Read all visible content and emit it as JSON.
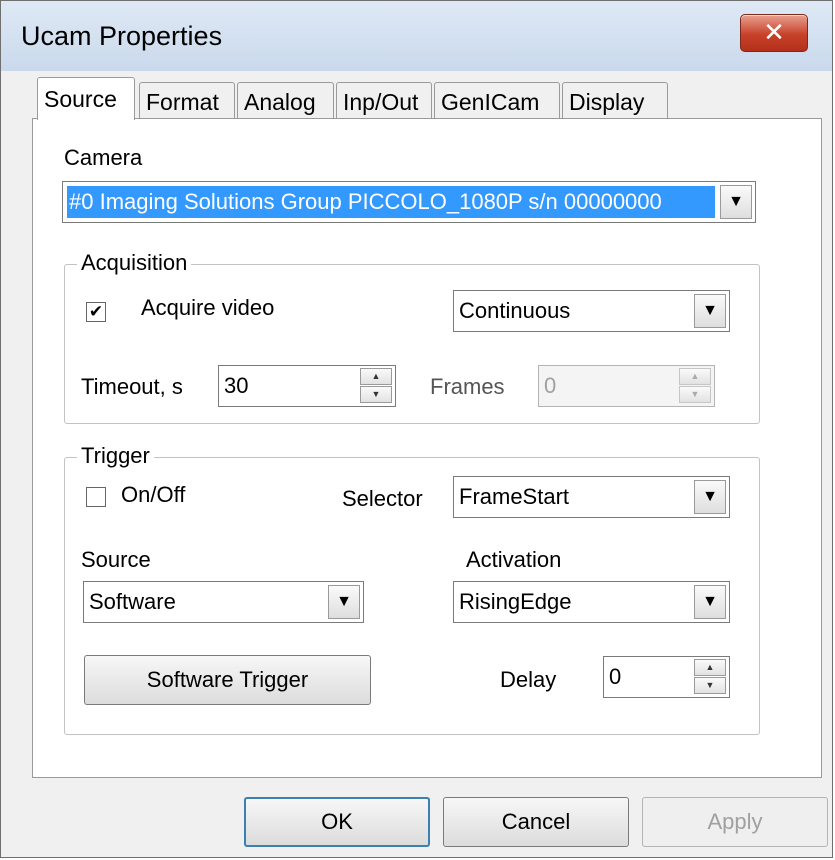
{
  "window": {
    "title": "Ucam Properties",
    "close_label": "✕"
  },
  "tabs": [
    {
      "label": "Source"
    },
    {
      "label": "Format"
    },
    {
      "label": "Analog"
    },
    {
      "label": "Inp/Out"
    },
    {
      "label": "GenICam"
    },
    {
      "label": "Display"
    }
  ],
  "camera": {
    "label": "Camera",
    "value": "#0 Imaging Solutions Group PICCOLO_1080P s/n 00000000"
  },
  "acquisition": {
    "title": "Acquisition",
    "acquire_video_label": "Acquire video",
    "acquire_video_checked": "✔",
    "mode_value": "Continuous",
    "timeout_label": "Timeout, s",
    "timeout_value": "30",
    "frames_label": "Frames",
    "frames_value": "0"
  },
  "trigger": {
    "title": "Trigger",
    "onoff_label": "On/Off",
    "selector_label": "Selector",
    "selector_value": "FrameStart",
    "source_label": "Source",
    "source_value": "Software",
    "activation_label": "Activation",
    "activation_value": "RisingEdge",
    "software_trigger_label": "Software Trigger",
    "delay_label": "Delay",
    "delay_value": "0"
  },
  "buttons": {
    "ok": "OK",
    "cancel": "Cancel",
    "apply": "Apply"
  },
  "icons": {
    "dropdown": "▼",
    "spin_up": "▲",
    "spin_down": "▼"
  }
}
